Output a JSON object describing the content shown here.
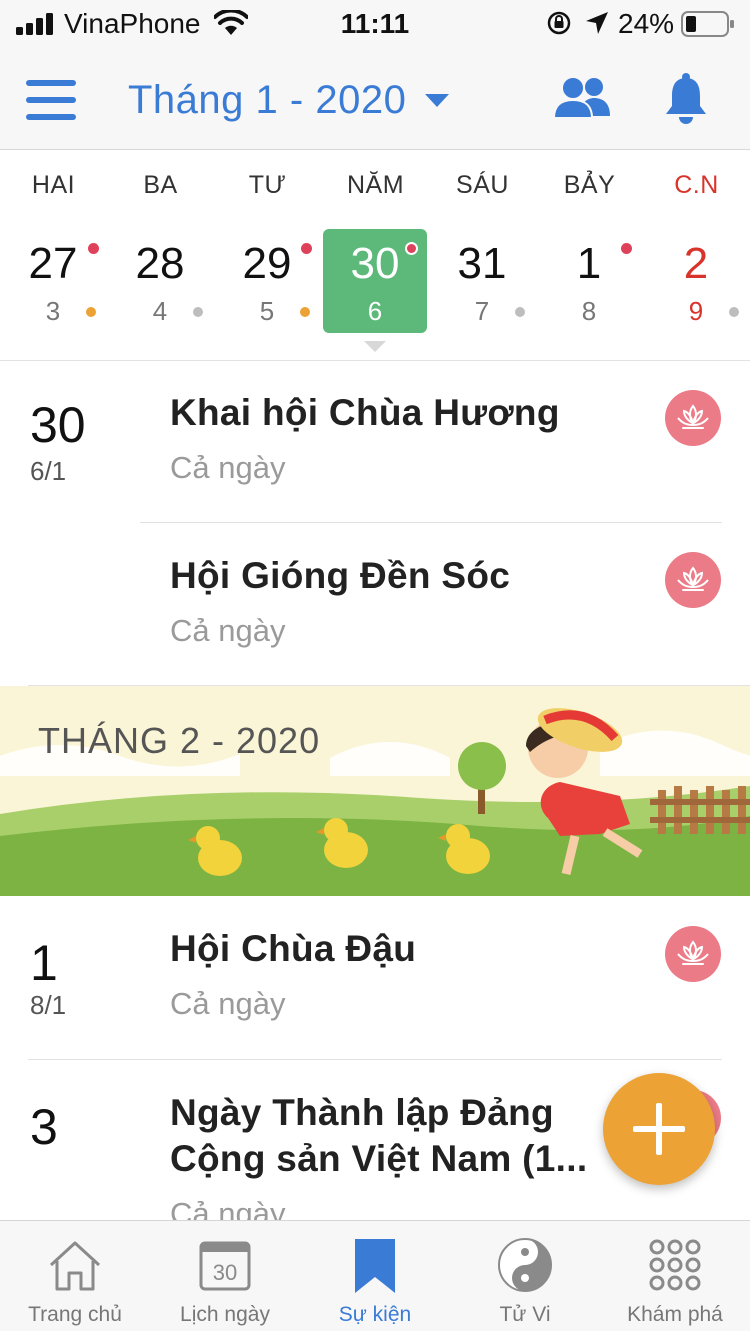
{
  "status_bar": {
    "carrier": "VinaPhone",
    "time": "11:11",
    "battery": "24%"
  },
  "header": {
    "title": "Tháng 1 - 2020"
  },
  "week": {
    "days": [
      {
        "name": "HAI",
        "date": "27",
        "lunar": "3",
        "top_dot": true,
        "bottom_dot": "#eca234",
        "selected": false,
        "sunday": false
      },
      {
        "name": "BA",
        "date": "28",
        "lunar": "4",
        "top_dot": false,
        "bottom_dot": "#bdbdbd",
        "selected": false,
        "sunday": false
      },
      {
        "name": "TƯ",
        "date": "29",
        "lunar": "5",
        "top_dot": true,
        "bottom_dot": "#eca234",
        "selected": false,
        "sunday": false
      },
      {
        "name": "NĂM",
        "date": "30",
        "lunar": "6",
        "top_dot": true,
        "bottom_dot": null,
        "selected": true,
        "sunday": false
      },
      {
        "name": "SÁU",
        "date": "31",
        "lunar": "7",
        "top_dot": false,
        "bottom_dot": "#bdbdbd",
        "selected": false,
        "sunday": false
      },
      {
        "name": "BẢY",
        "date": "1",
        "lunar": "8",
        "top_dot": true,
        "bottom_dot": null,
        "selected": false,
        "sunday": false
      },
      {
        "name": "C.N",
        "date": "2",
        "lunar": "9",
        "top_dot": false,
        "bottom_dot": "#bdbdbd",
        "selected": false,
        "sunday": true
      }
    ]
  },
  "events": {
    "group1": {
      "date": "30",
      "lunar": "6/1",
      "items": [
        {
          "title": "Khai hội Chùa Hương",
          "subtitle": "Cả ngày"
        },
        {
          "title": "Hội Gióng Đền Sóc",
          "subtitle": "Cả ngày"
        }
      ]
    },
    "banner": {
      "label": "THÁNG 2 - 2020"
    },
    "group2": {
      "date": "1",
      "lunar": "8/1",
      "items": [
        {
          "title": "Hội Chùa Đậu",
          "subtitle": "Cả ngày"
        }
      ]
    },
    "group3": {
      "date": "3",
      "items": [
        {
          "title_line1": "Ngày Thành lập Đảng",
          "title_line2": "Cộng sản Việt Nam (1...",
          "subtitle": "Cả ngày"
        }
      ]
    }
  },
  "tabbar": {
    "tabs": [
      {
        "label": "Trang chủ",
        "icon": "home-icon"
      },
      {
        "label": "Lịch ngày",
        "icon": "calendar-day-icon",
        "icon_text": "30"
      },
      {
        "label": "Sự kiện",
        "icon": "bookmark-icon"
      },
      {
        "label": "Tử Vi",
        "icon": "yin-yang-icon"
      },
      {
        "label": "Khám phá",
        "icon": "grid-icon"
      }
    ],
    "active_index": 2
  },
  "colors": {
    "accent": "#3a7bd5",
    "selected_day": "#5cb97a",
    "sunday": "#d9342b",
    "event_dot": "#e0415a",
    "lotus_button": "#ec7b88",
    "fab": "#eca234"
  }
}
